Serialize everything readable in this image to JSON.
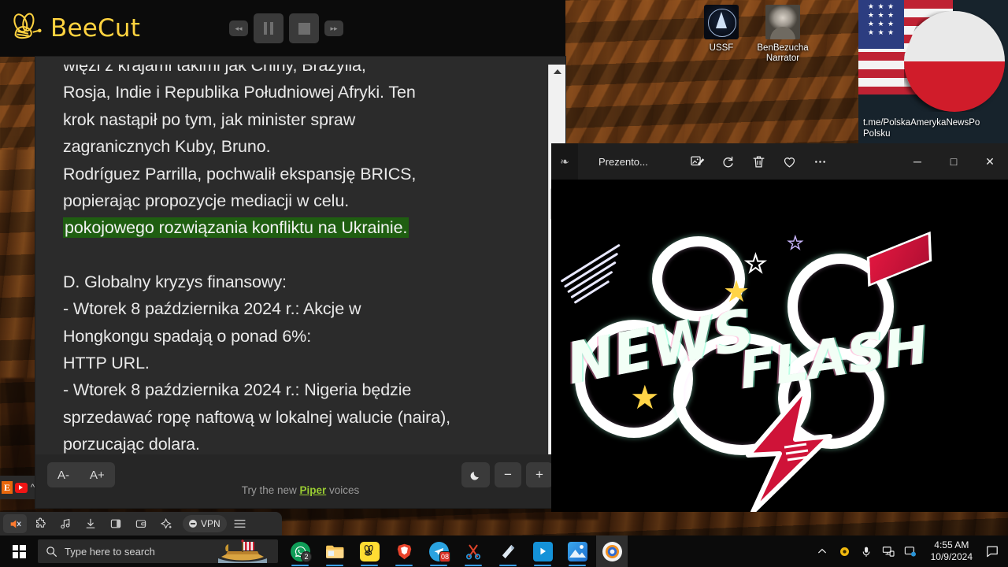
{
  "desktop": {
    "icons": [
      {
        "name": "USSF",
        "label": "USSF",
        "icon": "space-force-badge-icon"
      },
      {
        "name": "BenBezucha Narrator",
        "label_line1": "BenBezucha",
        "label_line2": "Narrator",
        "icon": "narrator-photo-icon"
      }
    ],
    "telegram_banner": {
      "label_line1": "t.me/PolskaAmerykaNewsPo",
      "label_line2": "Polsku",
      "icon": "usa-poland-flag-icon"
    }
  },
  "beecut": {
    "brand": "BeeCut",
    "logo_icon": "bee-icon",
    "controls": [
      {
        "name": "rewind",
        "icon": "rewind-icon",
        "glyph": "◂◂"
      },
      {
        "name": "pause",
        "icon": "pause-icon"
      },
      {
        "name": "stop",
        "icon": "stop-icon"
      },
      {
        "name": "fast-forward",
        "icon": "fast-forward-icon",
        "glyph": "▸▸"
      }
    ]
  },
  "reader": {
    "lines": [
      {
        "text": "więzi z krajami takimi jak Chiny, Brazylia,",
        "style": "clipped"
      },
      {
        "text": "Rosja, Indie i Republika Południowej Afryki. Ten",
        "style": "normal"
      },
      {
        "text": "krok nastąpił po tym, jak minister spraw",
        "style": "normal"
      },
      {
        "text": "zagranicznych Kuby, Bruno.",
        "style": "normal"
      },
      {
        "text": "Rodríguez Parrilla, pochwalił ekspansję BRICS,",
        "style": "normal"
      },
      {
        "text": "popierając propozycje mediacji w celu.",
        "style": "normal"
      },
      {
        "text": "pokojowego rozwiązania konfliktu na Ukrainie.",
        "style": "highlight"
      },
      {
        "text": "",
        "style": "blank"
      },
      {
        "text": "D. Globalny kryzys finansowy:",
        "style": "normal"
      },
      {
        "text": "- Wtorek 8 października 2024 r.: Akcje w",
        "style": "normal"
      },
      {
        "text": "Hongkongu spadają o ponad 6%:",
        "style": "normal"
      },
      {
        "text": "HTTP URL.",
        "style": "normal"
      },
      {
        "text": "- Wtorek 8 października 2024 r.: Nigeria będzie",
        "style": "normal"
      },
      {
        "text": "sprzedawać ropę naftową w lokalnej walucie (naira),",
        "style": "normal"
      },
      {
        "text": "porzucając dolara.",
        "style": "normal"
      }
    ],
    "highlight_color": "#1f5e11",
    "toolbar": {
      "font_decrease": "A-",
      "font_increase": "A+",
      "dark_mode_icon": "moon-icon",
      "zoom_out": "−",
      "zoom_in": "+",
      "promo_prefix": "Try the new ",
      "promo_link": "Piper",
      "promo_suffix": " voices"
    },
    "scrollbar": {
      "up_icon": "scroll-up-arrow-icon",
      "down_icon": "scroll-down-arrow-icon"
    }
  },
  "photos_window": {
    "title": "Prezento...",
    "tab_icon": "photos-app-icon",
    "tools": [
      {
        "name": "edit-image",
        "icon": "edit-image-icon"
      },
      {
        "name": "rotate",
        "icon": "rotate-icon"
      },
      {
        "name": "delete",
        "icon": "trash-icon"
      },
      {
        "name": "favorite",
        "icon": "heart-icon"
      },
      {
        "name": "more-options",
        "icon": "ellipsis-icon"
      }
    ],
    "window_controls": [
      {
        "name": "minimize",
        "glyph": "─"
      },
      {
        "name": "maximize",
        "glyph": "□"
      },
      {
        "name": "close",
        "glyph": "✕"
      }
    ],
    "image": {
      "title_word1": "NEWS",
      "title_word2": "FLASH",
      "background": "#000000",
      "accent_red": "#cf1338",
      "accent_yellow": "#ffd447"
    }
  },
  "brave_toolbar": {
    "items": [
      {
        "name": "audio-muted",
        "icon": "speaker-icon"
      },
      {
        "name": "extensions",
        "icon": "puzzle-icon"
      },
      {
        "name": "music",
        "icon": "music-note-icon"
      },
      {
        "name": "downloads",
        "icon": "download-icon"
      },
      {
        "name": "sidebar",
        "icon": "sidebar-icon"
      },
      {
        "name": "wallet",
        "icon": "wallet-icon"
      },
      {
        "name": "leo-ai",
        "icon": "sparkle-icon"
      }
    ],
    "vpn_label": "VPN",
    "menu_icon": "hamburger-menu-icon",
    "tray": [
      {
        "name": "everything-search",
        "label": "E"
      },
      {
        "name": "youtube",
        "icon": "youtube-icon"
      }
    ]
  },
  "taskbar": {
    "start_icon": "windows-start-icon",
    "search": {
      "placeholder": "Type here to search",
      "icon": "search-icon",
      "decoration": "viking-ship-icon"
    },
    "apps": [
      {
        "name": "whatsapp",
        "icon": "whatsapp-icon",
        "badge": "2",
        "state": "running"
      },
      {
        "name": "file-explorer",
        "icon": "folder-icon",
        "badge": "",
        "state": "running"
      },
      {
        "name": "beecut",
        "icon": "bee-icon",
        "badge": "",
        "state": "running"
      },
      {
        "name": "brave-browser",
        "icon": "brave-lion-icon",
        "badge": "",
        "state": "running"
      },
      {
        "name": "telegram",
        "icon": "telegram-icon",
        "badge": "08",
        "state": "running"
      },
      {
        "name": "snipping-tool",
        "icon": "scissors-icon",
        "badge": "",
        "state": "running"
      },
      {
        "name": "paper-app",
        "icon": "paper-icon",
        "badge": "",
        "state": "running"
      },
      {
        "name": "movies-tv",
        "icon": "play-icon",
        "badge": "",
        "state": "running"
      },
      {
        "name": "photos",
        "icon": "photos-icon",
        "badge": "",
        "state": "running"
      },
      {
        "name": "chrome-canary",
        "icon": "browser-circle-icon",
        "badge": "",
        "state": "focused"
      }
    ],
    "tray": {
      "chevron": "show-hidden-icons-icon",
      "icons": [
        {
          "name": "safe-eyes",
          "icon": "eye-icon"
        },
        {
          "name": "microphone",
          "icon": "microphone-icon"
        },
        {
          "name": "network",
          "icon": "network-icon"
        },
        {
          "name": "display-settings",
          "icon": "display-icon"
        }
      ],
      "time": "4:55 AM",
      "date": "10/9/2024",
      "action_center_icon": "action-center-icon"
    }
  }
}
